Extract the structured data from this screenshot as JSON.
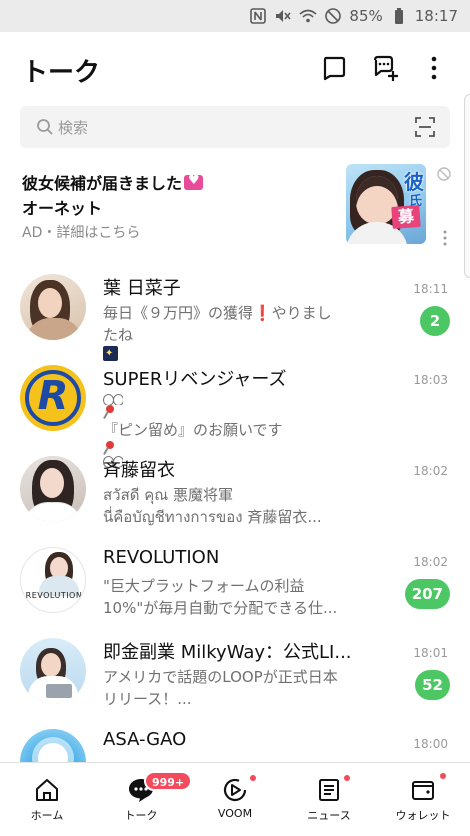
{
  "status_bar": {
    "battery": "85%",
    "time": "18:17"
  },
  "header": {
    "title": "トーク"
  },
  "search": {
    "placeholder": "検索"
  },
  "ad": {
    "title": "彼女候補が届きました",
    "brand": "オーネット",
    "meta": "AD・詳細はこちら",
    "image_text": [
      "彼",
      "氏",
      "募"
    ]
  },
  "chats": [
    {
      "name": "葉 日菜子",
      "msg_line1": "毎日《９万円》の獲得❗️やりまし",
      "msg_line2": "たね",
      "time": "18:11",
      "unread": "2"
    },
    {
      "name": "SUPERリベンジャーズ",
      "msg_line1": "『ピン留め』のお願いです",
      "msg_line2": "",
      "time": "18:03",
      "unread": ""
    },
    {
      "name": "斉藤留衣",
      "msg_line1": "สวัสดี คุณ 悪魔将軍",
      "msg_line2": "นี่คือบัญชีทางการของ 斉藤留衣...",
      "time": "18:02",
      "unread": ""
    },
    {
      "name": "REVOLUTION",
      "msg_line1": "\"巨大プラットフォームの利益",
      "msg_line2": "10%\"が毎月自動で分配できる仕...",
      "time": "18:02",
      "unread": "207"
    },
    {
      "name": "即金副業 MilkyWay：公式LI...",
      "msg_line1": "アメリカで話題のLOOPが正式日本",
      "msg_line2": "リリース！...",
      "time": "18:01",
      "unread": "52"
    },
    {
      "name": "ASA-GAO",
      "msg_line1": "",
      "msg_line2": "",
      "time": "18:00",
      "unread": ""
    }
  ],
  "avatars": {
    "revolution_text": "REVOLUTION",
    "super_letter": "R"
  },
  "nav": {
    "items": [
      {
        "label": "ホーム"
      },
      {
        "label": "トーク",
        "badge": "999+"
      },
      {
        "label": "VOOM"
      },
      {
        "label": "ニュース"
      },
      {
        "label": "ウォレット"
      }
    ]
  },
  "colors": {
    "unread_green": "#4cc764",
    "badge_red": "#f24b5b",
    "status_bar_bg": "#ebebeb"
  }
}
